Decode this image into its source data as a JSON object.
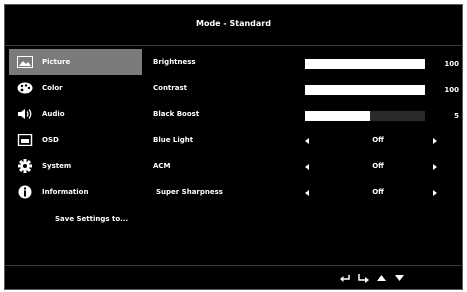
{
  "header": {
    "title": "Mode - Standard"
  },
  "sidebar": {
    "items": [
      {
        "label": "Picture",
        "icon": "picture-icon",
        "active": true
      },
      {
        "label": "Color",
        "icon": "palette-icon",
        "active": false
      },
      {
        "label": "Audio",
        "icon": "speaker-icon",
        "active": false
      },
      {
        "label": "OSD",
        "icon": "osd-icon",
        "active": false
      },
      {
        "label": "System",
        "icon": "gear-icon",
        "active": false
      },
      {
        "label": "Information",
        "icon": "info-icon",
        "active": false
      }
    ],
    "save_label": "Save Settings to..."
  },
  "settings": {
    "brightness": {
      "label": "Brightness",
      "value": "100",
      "level": 1.0
    },
    "contrast": {
      "label": "Contrast",
      "value": "100",
      "level": 1.0
    },
    "black_boost": {
      "label": "Black Boost",
      "value": "5",
      "level": 0.54
    },
    "blue_light": {
      "label": "Blue Light",
      "value": "Off"
    },
    "acm": {
      "label": "ACM",
      "value": "Off"
    },
    "super_sharpness": {
      "label": "Super Sharpness",
      "value": "Off"
    }
  },
  "footer": {
    "icons": [
      "exit-icon",
      "enter-icon",
      "up-arrow-icon",
      "down-arrow-icon"
    ]
  },
  "colors": {
    "background": "#000000",
    "active_item": "#7b7b7b",
    "text": "#ffffff"
  }
}
